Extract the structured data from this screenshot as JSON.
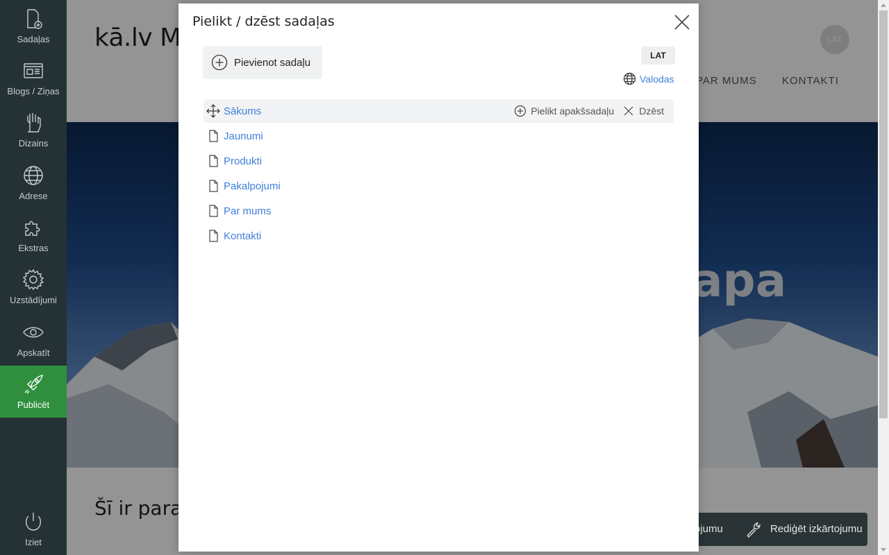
{
  "sidebar": {
    "items": [
      {
        "label": "Sadaļas",
        "icon": "add-page-icon"
      },
      {
        "label": "Blogs / Ziņas",
        "icon": "news-icon"
      },
      {
        "label": "Dizains",
        "icon": "design-hand-icon"
      },
      {
        "label": "Adrese",
        "icon": "globe-icon"
      },
      {
        "label": "Ekstras",
        "icon": "puzzle-icon"
      },
      {
        "label": "Uzstādījumi",
        "icon": "gear-icon"
      },
      {
        "label": "Apskatīt",
        "icon": "eye-icon"
      },
      {
        "label": "Publicēt",
        "icon": "rocket-icon"
      },
      {
        "label": "Iziet",
        "icon": "power-icon"
      }
    ],
    "active_color": "#2f8f3f"
  },
  "site": {
    "title": "kā.lv Mo",
    "lang_circle": "LAT",
    "nav": [
      "PAR MUMS",
      "KONTAKTI"
    ],
    "hero_text": "apa",
    "subheading": "Šī ir parau",
    "bottom_bar": {
      "partial_label": "ojumu",
      "edit_layout_label": "Rediģēt izkārtojumu"
    }
  },
  "modal": {
    "title": "Pielikt / dzēst sadaļas",
    "add_section_label": "Pievienot sadaļu",
    "language_badge": "LAT",
    "languages_link": "Valodas",
    "sections": [
      {
        "label": "Sākums",
        "icon": "move-icon"
      },
      {
        "label": "Jaunumi",
        "icon": "page-icon"
      },
      {
        "label": "Produkti",
        "icon": "page-icon"
      },
      {
        "label": "Pakalpojumi",
        "icon": "page-icon"
      },
      {
        "label": "Par mums",
        "icon": "page-icon"
      },
      {
        "label": "Kontakti",
        "icon": "page-icon"
      }
    ],
    "row_actions": {
      "add_subsection": "Pielikt apakšsadaļu",
      "delete": "Dzēst"
    },
    "link_color": "#3f7fd9"
  }
}
